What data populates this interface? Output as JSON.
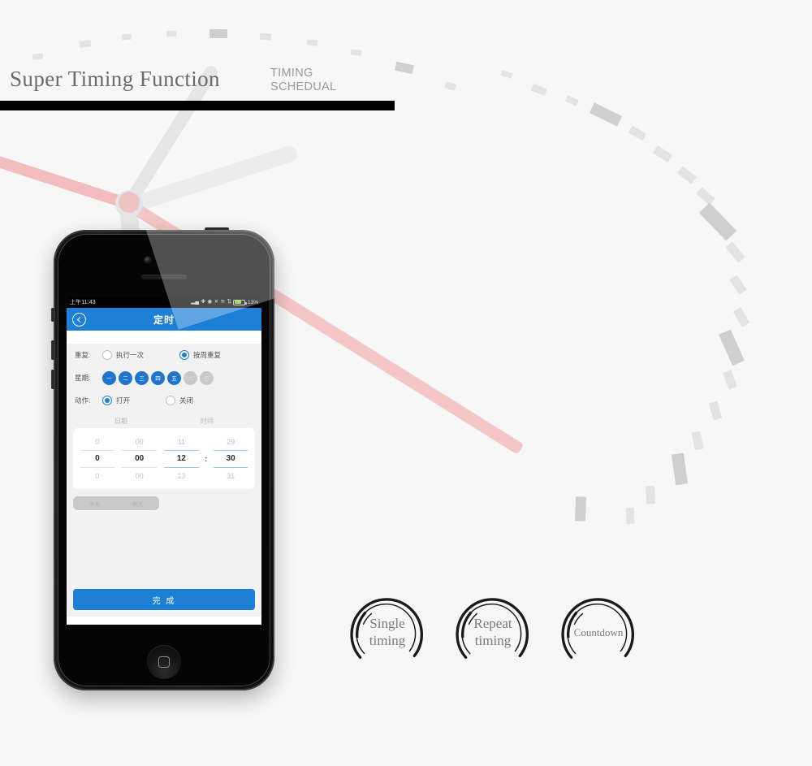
{
  "header": {
    "title": "Super Timing Function",
    "subtitle_line1": "TIMING",
    "subtitle_line2": "SCHEDUAL"
  },
  "phone": {
    "statusbar": {
      "time": "上午11:43",
      "battery_percent": "13%",
      "icons": [
        "signal-icon",
        "bluetooth-icon",
        "alarm-icon",
        "silent-icon",
        "wifi-icon",
        "sync-icon"
      ]
    },
    "navbar": {
      "title": "定时",
      "back_label": "back-chevron"
    },
    "form": {
      "repeat": {
        "label": "重复:",
        "options": [
          {
            "label": "执行一次",
            "selected": false
          },
          {
            "label": "按周重复",
            "selected": true
          }
        ]
      },
      "week": {
        "label": "星期:",
        "days": [
          {
            "label": "一",
            "selected": true
          },
          {
            "label": "二",
            "selected": true
          },
          {
            "label": "三",
            "selected": true
          },
          {
            "label": "四",
            "selected": true
          },
          {
            "label": "五",
            "selected": true
          },
          {
            "label": "六",
            "selected": false
          },
          {
            "label": "日",
            "selected": false
          }
        ]
      },
      "action": {
        "label": "动作:",
        "options": [
          {
            "label": "打开",
            "selected": true
          },
          {
            "label": "关闭",
            "selected": false
          }
        ]
      }
    },
    "picker": {
      "header_date": "日期",
      "header_time": "时间",
      "columns": {
        "day": [
          "0",
          "0",
          "0"
        ],
        "month": [
          "00",
          "00",
          "00"
        ],
        "hour": [
          "11",
          "12",
          "13"
        ],
        "minute": [
          "29",
          "30",
          "31"
        ]
      },
      "separator": ":"
    },
    "quick_tabs": [
      {
        "label": "今天"
      },
      {
        "label": "明天"
      }
    ],
    "done_button": "完 成"
  },
  "badges": [
    {
      "line1": "Single",
      "line2": "timing"
    },
    {
      "line1": "Repeat",
      "line2": "timing"
    },
    {
      "line1": "Countdown",
      "line2": ""
    }
  ],
  "colors": {
    "accent_blue": "#1d7fd6",
    "day_blue": "#2275cc",
    "picker_blue": "#8fd0ef",
    "hand_pink": "#f3bdbd",
    "background": "#f7f7f7"
  }
}
